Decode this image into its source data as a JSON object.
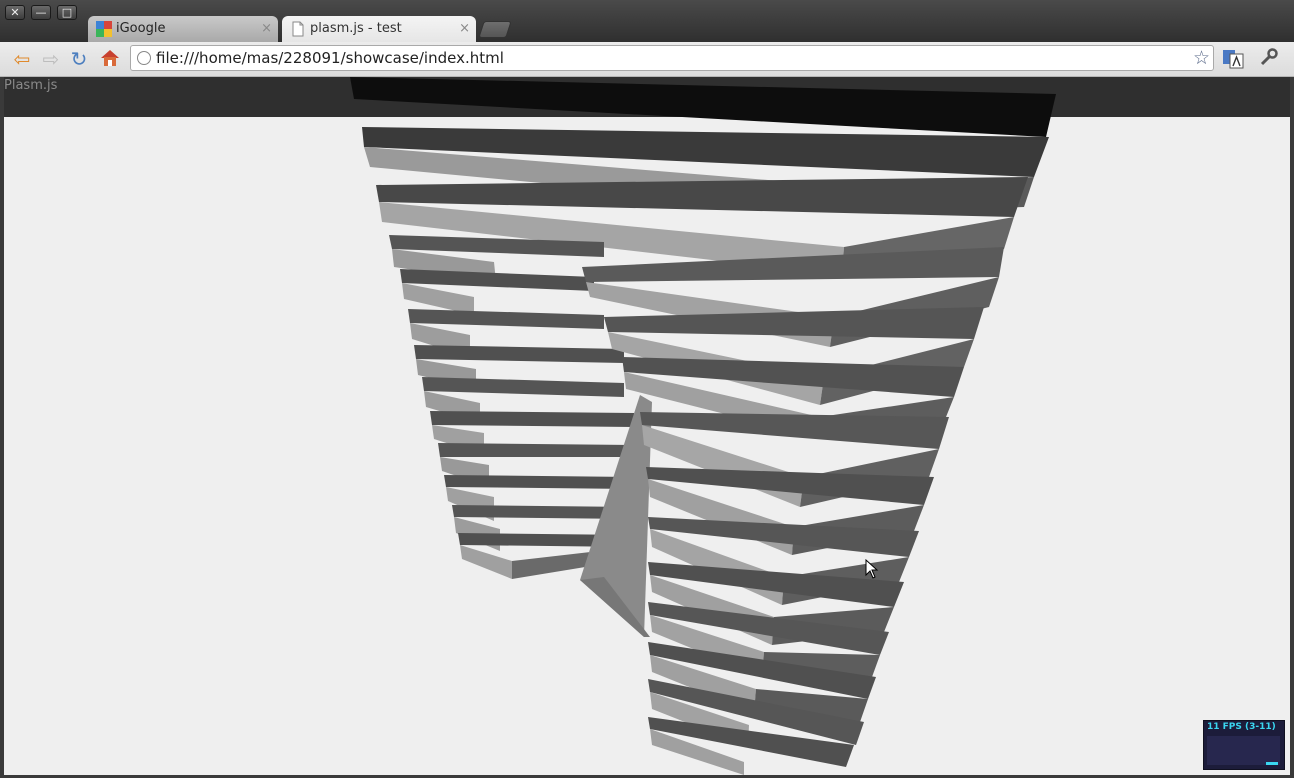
{
  "window": {
    "close_glyph": "✕",
    "min_glyph": "—",
    "max_glyph": "□"
  },
  "tabs": [
    {
      "title": "iGoogle",
      "close": "×",
      "icon": "igoogle-icon"
    },
    {
      "title": "plasm.js - test",
      "close": "×",
      "icon": "page-icon"
    }
  ],
  "toolbar": {
    "back_glyph": "⇦",
    "forward_glyph": "⇨",
    "reload_glyph": "↻",
    "url": "file:///home/mas/228091/showcase/index.html",
    "star_glyph": "☆",
    "wrench_glyph": "🔧"
  },
  "page": {
    "brand": "Plasm.js",
    "fps_text": "11 FPS (3-11)"
  },
  "colors": {
    "background": "#efefef",
    "topbar": "#2f2f2f",
    "fps_text": "#3ad7f0"
  }
}
